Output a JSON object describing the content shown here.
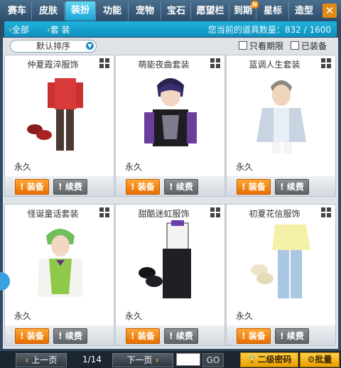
{
  "tabs": [
    "赛车",
    "皮肤",
    "装扮",
    "功能",
    "宠物",
    "宝石",
    "愿望栏",
    "到期",
    "星标",
    "造型"
  ],
  "active_tab": 2,
  "tab_badge": "N",
  "close_label": "✕",
  "subbar": {
    "all": "全部",
    "set": "套 装",
    "count_text": "您当前的道具数量：832 / 1600"
  },
  "toolbar": {
    "sort_label": "默认排序",
    "only_expiring": "只看期限",
    "equipped": "已装备"
  },
  "items": [
    {
      "name": "仲夏霞淬服饰",
      "duration": "永久",
      "equip": "装备",
      "renew": "续费"
    },
    {
      "name": "萌能夜曲套装",
      "duration": "永久",
      "equip": "装备",
      "renew": "续费"
    },
    {
      "name": "蓝调人生套装",
      "duration": "永久",
      "equip": "装备",
      "renew": "续费"
    },
    {
      "name": "怪诞童话套装",
      "duration": "永久",
      "equip": "装备",
      "renew": "续费"
    },
    {
      "name": "甜酷迷虹服饰",
      "duration": "永久",
      "equip": "装备",
      "renew": "续费"
    },
    {
      "name": "初夏花信服饰",
      "duration": "永久",
      "equip": "装备",
      "renew": "续费"
    }
  ],
  "pager": {
    "prev": "上一页",
    "page": "1/14",
    "next": "下一页",
    "go": "GO",
    "password": "二级密码",
    "batch": "批量"
  },
  "colors": {
    "accent": "#1ba3d4",
    "equip": "#f28a10",
    "renew": "#6b7075"
  }
}
